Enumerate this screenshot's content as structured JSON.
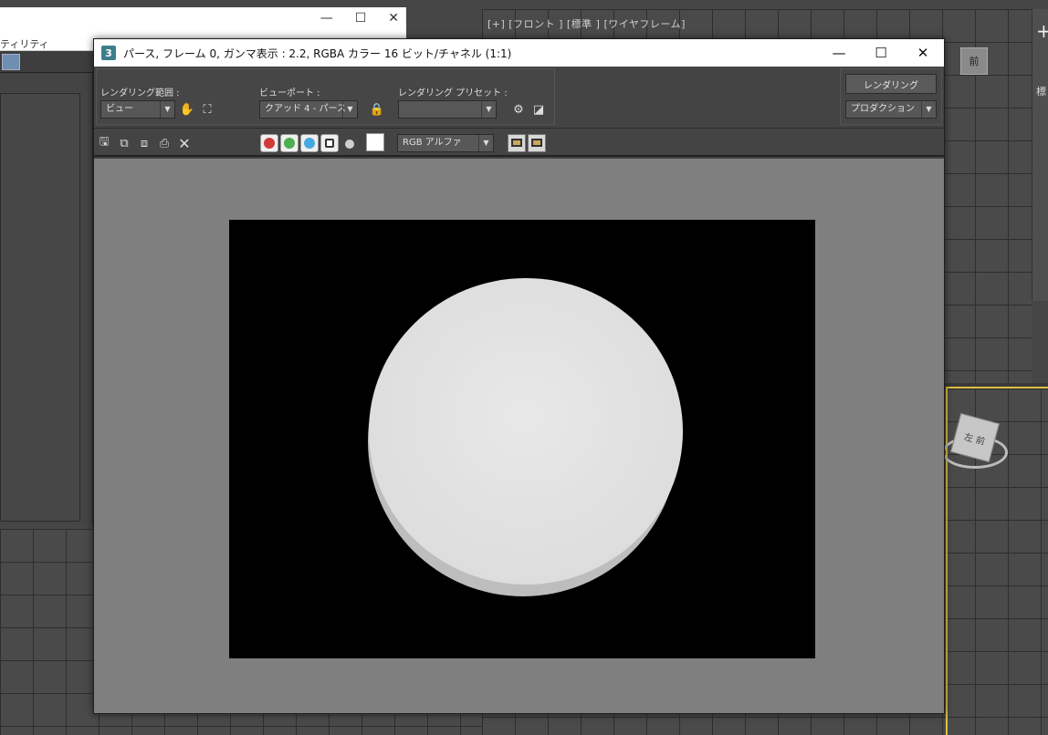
{
  "background": {
    "viewport_label": "[+] [フロント ] [標準 ] [ワイヤフレーム]",
    "viewcube_front_label": "前",
    "viewcube_persp_label": "左 前",
    "behind_window_title": "ティリティ",
    "right_panel_label": "標",
    "right_panel_plus": "+"
  },
  "window": {
    "app_icon": "3",
    "title": "パース, フレーム 0, ガンマ表示 : 2.2, RGBA カラー 16 ビット/チャネル (1:1)",
    "minimize": "—",
    "maximize": "☐",
    "close": "✕"
  },
  "render_setup": {
    "area_label": "レンダリング範囲 :",
    "area_value": "ビュー",
    "viewport_label": "ビューポート :",
    "viewport_value": "クアッド 4 - パース",
    "preset_label": "レンダリング プリセット :",
    "preset_value": "",
    "render_button": "レンダリング",
    "mode_value": "プロダクション",
    "dropdown_arrow": "▼"
  },
  "toolbar": {
    "channel_display": "RGB アルファ",
    "icons": [
      "save-icon",
      "copy-icon",
      "clone-icon",
      "print-icon",
      "clear-icon"
    ],
    "colors": {
      "red": "#d23a3a",
      "green": "#4caf50",
      "blue": "#45a8e0"
    }
  },
  "render_output": {
    "background_color": "#000000",
    "object": "cylinder",
    "object_color": "#e6e6e6"
  }
}
